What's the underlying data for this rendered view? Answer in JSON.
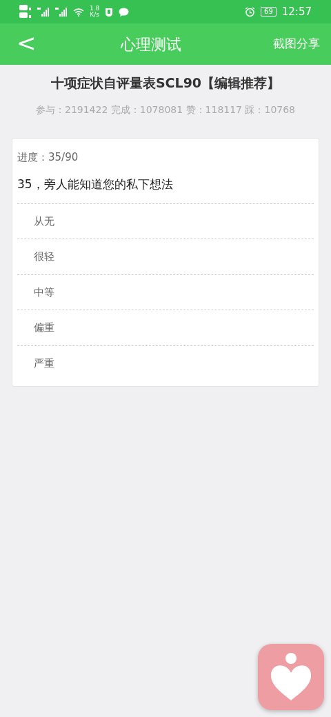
{
  "status_bar": {
    "speed_value": "1.8",
    "speed_unit": "K/s",
    "battery": "69",
    "time": "12:57"
  },
  "header": {
    "back": "<",
    "title": "心理测试",
    "action": "截图分享"
  },
  "quiz": {
    "title": "十项症状自评量表SCL90【编辑推荐】",
    "stats": "参与：2191422 完成：1078081 赞：118117 踩：10768"
  },
  "question": {
    "progress": "进度：35/90",
    "text": "35，旁人能知道您的私下想法",
    "options": [
      {
        "label": "从无",
        "selected": false
      },
      {
        "label": "很轻",
        "selected": false
      },
      {
        "label": "中等",
        "selected": false
      },
      {
        "label": "偏重",
        "selected": false
      },
      {
        "label": "严重",
        "selected": false
      }
    ]
  }
}
